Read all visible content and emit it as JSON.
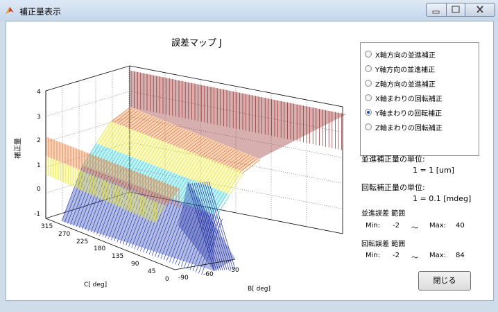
{
  "window": {
    "title": "補正量表示",
    "buttons": {
      "minimize": "minimize",
      "maximize": "maximize",
      "close": "close"
    }
  },
  "plot": {
    "title": "誤差マップ J",
    "zlabel": "補正量",
    "xlabel": "C[ deg]",
    "ylabel": "B[ deg]",
    "z_ticks": [
      "4",
      "3",
      "2",
      "1",
      "0",
      "-1"
    ],
    "c_ticks": [
      "315",
      "270",
      "225",
      "180",
      "135",
      "90",
      "45",
      "0"
    ],
    "b_ticks": [
      "-90",
      "-60",
      "-30"
    ]
  },
  "options": {
    "items": [
      {
        "label": "X軸方向の並進補正",
        "checked": false
      },
      {
        "label": "Y軸方向の並進補正",
        "checked": false
      },
      {
        "label": "Z軸方向の並進補正",
        "checked": false
      },
      {
        "label": "X軸まわりの回転補正",
        "checked": false
      },
      {
        "label": "Y軸まわりの回転補正",
        "checked": true
      },
      {
        "label": "Z軸まわりの回転補正",
        "checked": false
      }
    ]
  },
  "info": {
    "translation_unit_label": "並進補正量の単位:",
    "translation_unit_value": "1 = 1 [um]",
    "rotation_unit_label": "回転補正量の単位:",
    "rotation_unit_value": "1 = 0.1 [mdeg]",
    "translation_range_label": "並進誤差 範囲",
    "translation_min_label": "Min:",
    "translation_min": "-2",
    "translation_tilde": "〜",
    "translation_max_label": "Max:",
    "translation_max": "40",
    "rotation_range_label": "回転誤差 範囲",
    "rotation_min_label": "Min:",
    "rotation_min": "-2",
    "rotation_tilde": "〜",
    "rotation_max_label": "Max:",
    "rotation_max": "84"
  },
  "close_button": {
    "label": "閉じる"
  }
}
